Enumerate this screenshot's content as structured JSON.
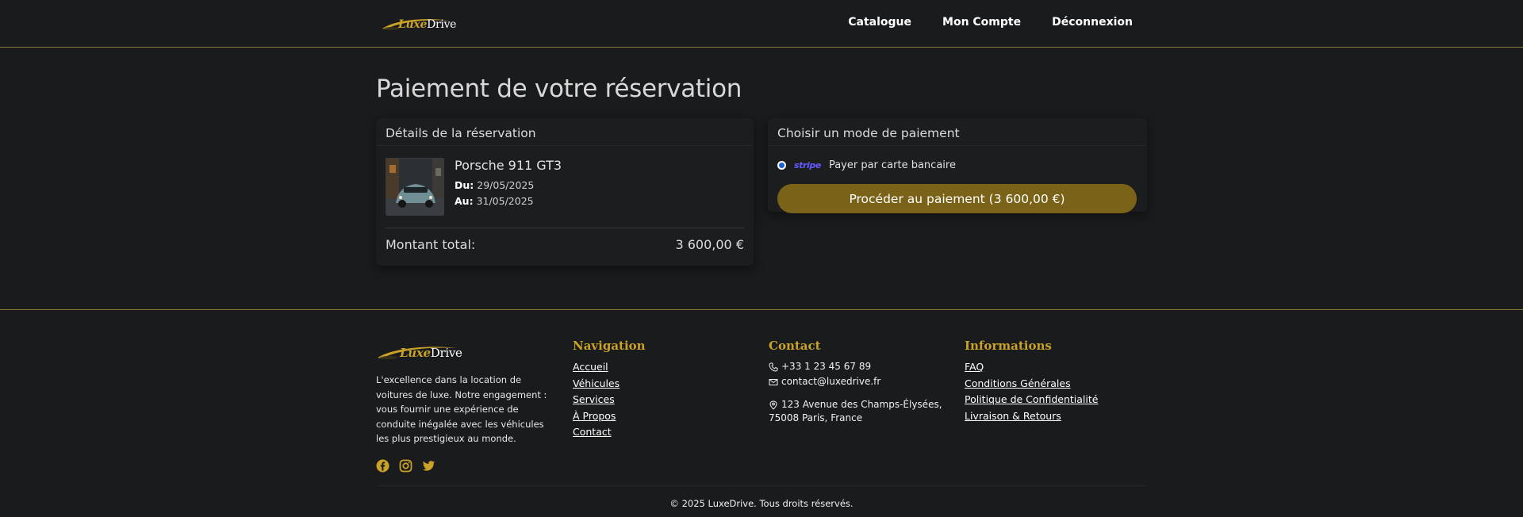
{
  "brand": {
    "part1": "Luxe",
    "part2": "Drive",
    "accent": "#c9a227"
  },
  "nav": {
    "items": [
      "Catalogue",
      "Mon Compte",
      "Déconnexion"
    ]
  },
  "page": {
    "title": "Paiement de votre réservation"
  },
  "reservation": {
    "heading": "Détails de la réservation",
    "vehicle_name": "Porsche 911 GT3",
    "from_label": "Du:",
    "from_date": "29/05/2025",
    "to_label": "Au:",
    "to_date": "31/05/2025",
    "total_label": "Montant total:",
    "total_value": "3 600,00 €"
  },
  "payment": {
    "heading": "Choisir un mode de paiement",
    "provider": "stripe",
    "option_label": "Payer par carte bancaire",
    "selected": true,
    "button_label": "Procéder au paiement (3 600,00 €)",
    "button_color": "#7a6318"
  },
  "footer": {
    "tagline": "L'excellence dans la location de voitures de luxe. Notre engagement : vous fournir une expérience de conduite inégalée avec les véhicules les plus prestigieux au monde.",
    "socials": [
      "facebook-icon",
      "instagram-icon",
      "twitter-icon"
    ],
    "navigation": {
      "title": "Navigation",
      "links": [
        "Accueil",
        "Véhicules",
        "Services",
        "À Propos",
        "Contact"
      ]
    },
    "contact": {
      "title": "Contact",
      "phone": "+33 1 23 45 67 89",
      "email": "contact@luxedrive.fr",
      "address_line1": "123 Avenue des Champs-Élysées,",
      "address_line2": "75008 Paris, France"
    },
    "informations": {
      "title": "Informations",
      "links": [
        "FAQ",
        "Conditions Générales",
        "Politique de Confidentialité",
        "Livraison & Retours"
      ]
    },
    "copyright": "© 2025 LuxeDrive. Tous droits réservés."
  }
}
